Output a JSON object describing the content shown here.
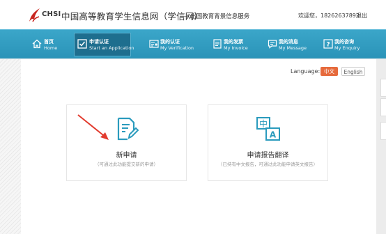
{
  "header": {
    "logo_text": "CHSI",
    "title": "中国高等教育学生信息网（学信网）",
    "subtitle": "— 出国教育背景信息服务",
    "welcome": "欢迎您，18262637892",
    "logout": "退出"
  },
  "nav": [
    {
      "label": "首页",
      "sub": "Home",
      "icon": "home-icon"
    },
    {
      "label": "申请认证",
      "sub": "Start an Application",
      "icon": "checkbox-icon"
    },
    {
      "label": "我的认证",
      "sub": "My Verification",
      "icon": "certificate-icon"
    },
    {
      "label": "我的发票",
      "sub": "My Invoice",
      "icon": "invoice-icon"
    },
    {
      "label": "我的消息",
      "sub": "My Message",
      "icon": "message-icon"
    },
    {
      "label": "我的咨询",
      "sub": "My Enquiry",
      "icon": "question-icon"
    }
  ],
  "language": {
    "label": "Language:",
    "options": [
      "中文",
      "English"
    ],
    "selected": "中文"
  },
  "cards": [
    {
      "title": "新申请",
      "desc": "（可通过此功能提交新的申请）",
      "icon": "edit-document-icon"
    },
    {
      "title": "申请报告翻译",
      "desc": "（已持有中文报告，可通过此功能申请英文报告）",
      "icon": "translate-icon"
    }
  ],
  "colors": {
    "nav_bg": "#2f9bc0",
    "nav_active": "#1e6e8e",
    "accent_orange": "#e66a3c",
    "card_icon": "#2a9bbd",
    "arrow_red": "#e23b2e"
  }
}
